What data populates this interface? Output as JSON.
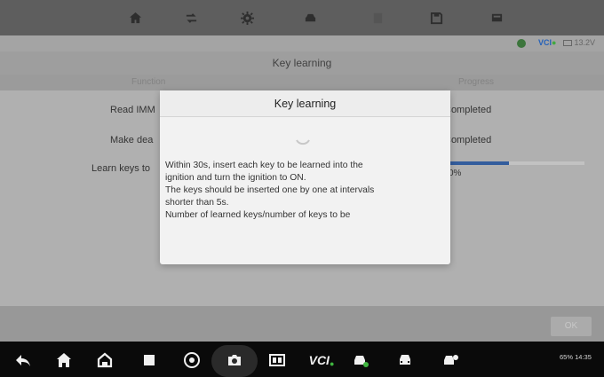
{
  "header": {
    "icons": [
      "home-icon",
      "swap-icon",
      "gear-icon",
      "car-icon",
      "stop-icon",
      "save-icon",
      "message-icon"
    ]
  },
  "status": {
    "vci_label": "VCI",
    "battery_label": "13.2V"
  },
  "page": {
    "title": "Key learning",
    "col_function": "Function",
    "col_progress": "Progress",
    "rows": [
      {
        "label": "Read IMM",
        "value": "Completed"
      },
      {
        "label": "Make dea",
        "value": "Completed"
      },
      {
        "label": "Learn keys to",
        "value": "0%"
      }
    ],
    "progress_fraction": 0.52,
    "ok_label": "OK"
  },
  "dialog": {
    "title": "Key learning",
    "line1": "Within 30s, insert each key to be learned into the",
    "line2": "ignition and turn the ignition to ON.",
    "line3": "The keys should be inserted one by one at intervals",
    "line4": "shorter than 5s.",
    "line5": "Number of learned keys/number of keys to be"
  },
  "navbar": {
    "vci_label": "VCI",
    "system_status": "65% 14:35"
  },
  "colors": {
    "progress": "#2f5fa8",
    "vci_green": "#3fb43f",
    "vci_blue": "#1e63c8"
  }
}
